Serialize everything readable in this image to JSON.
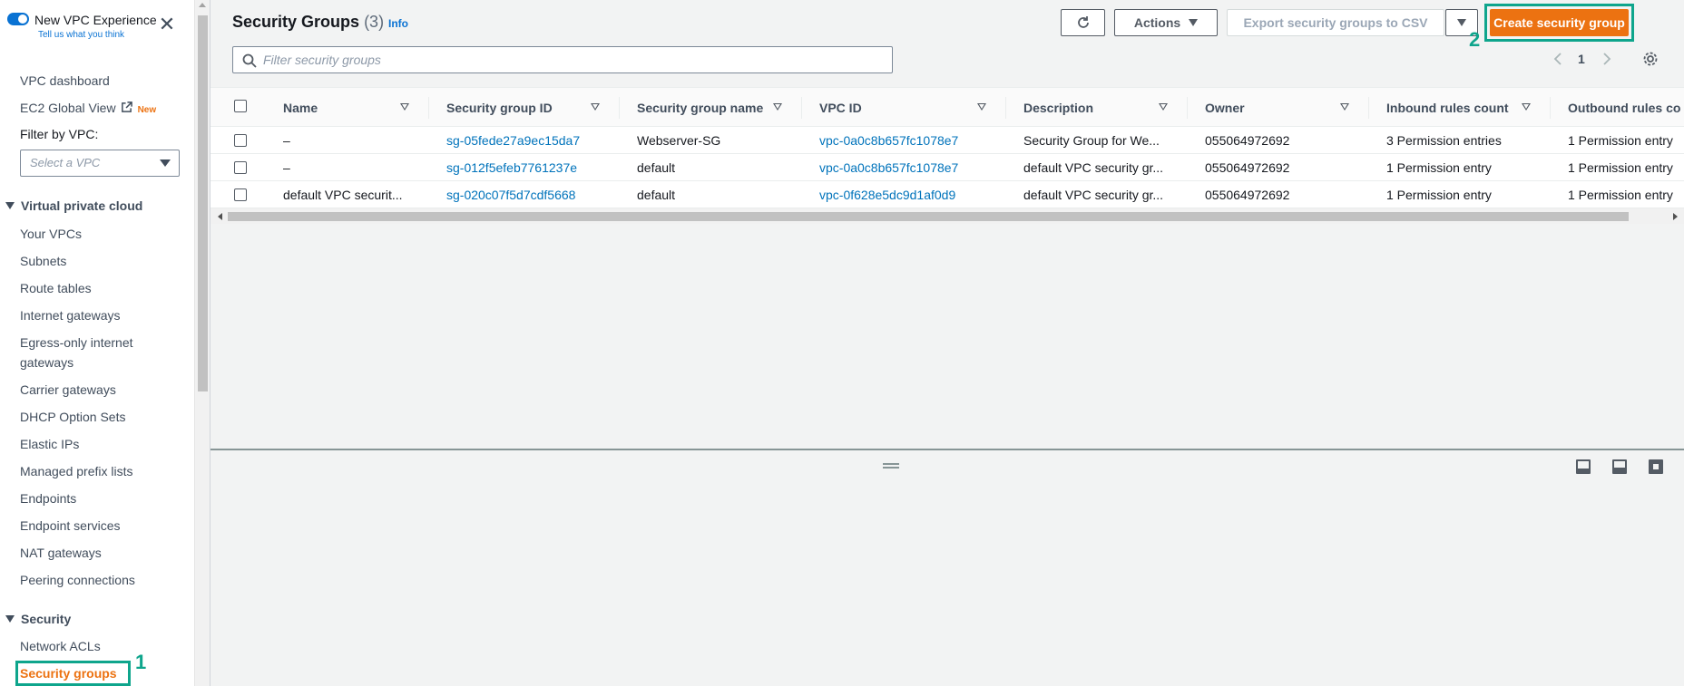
{
  "sidebar": {
    "experience_title": "New VPC Experience",
    "experience_link": "Tell us what you think",
    "close_glyph": "✕",
    "top_items": [
      {
        "label": "VPC dashboard"
      },
      {
        "label": "EC2 Global View",
        "badge": "New"
      }
    ],
    "filter_label": "Filter by VPC:",
    "filter_placeholder": "Select a VPC",
    "vpc_section": {
      "title": "Virtual private cloud",
      "items": [
        "Your VPCs",
        "Subnets",
        "Route tables",
        "Internet gateways",
        "Egress-only internet gateways",
        "Carrier gateways",
        "DHCP Option Sets",
        "Elastic IPs",
        "Managed prefix lists",
        "Endpoints",
        "Endpoint services",
        "NAT gateways",
        "Peering connections"
      ]
    },
    "security_section": {
      "title": "Security",
      "items": [
        "Network ACLs",
        "Security groups"
      ],
      "active": "Security groups"
    }
  },
  "annotations": {
    "step1": "1",
    "step2": "2",
    "color": "#0ea58c"
  },
  "header": {
    "title": "Security Groups",
    "count": "(3)",
    "info": "Info",
    "actions_label": "Actions",
    "export_label": "Export security groups to CSV",
    "create_label": "Create security group",
    "refresh_icon": "refresh-icon"
  },
  "search": {
    "placeholder": "Filter security groups"
  },
  "pagination": {
    "page": "1"
  },
  "table": {
    "columns": [
      "Name",
      "Security group ID",
      "Security group name",
      "VPC ID",
      "Description",
      "Owner",
      "Inbound rules count",
      "Outbound rules co"
    ],
    "rows": [
      [
        "–",
        "sg-05fede27a9ec15da7",
        "Webserver-SG",
        "vpc-0a0c8b657fc1078e7",
        "Security Group for We...",
        "055064972692",
        "3 Permission entries",
        "1 Permission entry"
      ],
      [
        "–",
        "sg-012f5efeb7761237e",
        "default",
        "vpc-0a0c8b657fc1078e7",
        "default VPC security gr...",
        "055064972692",
        "1 Permission entry",
        "1 Permission entry"
      ],
      [
        "default VPC securit...",
        "sg-020c07f5d7cdf5668",
        "default",
        "vpc-0f628e5dc9d1af0d9",
        "default VPC security gr...",
        "055064972692",
        "1 Permission entry",
        "1 Permission entry"
      ]
    ]
  },
  "colors": {
    "accent": "#ec7211",
    "link": "#0073bb"
  }
}
